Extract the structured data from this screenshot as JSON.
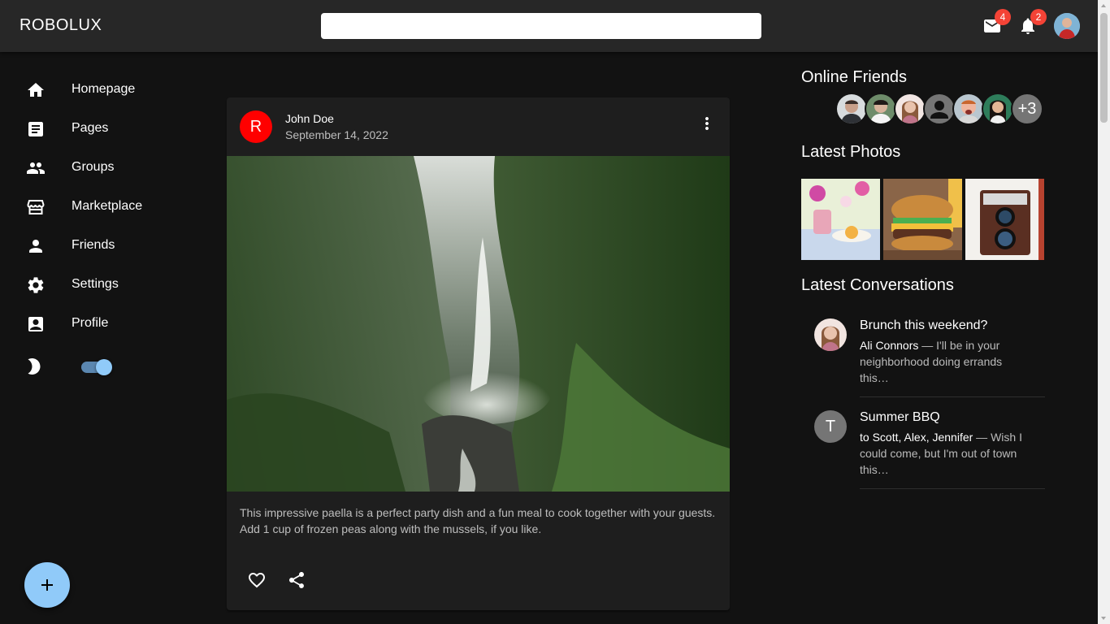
{
  "app": {
    "brand": "ROBOLUX"
  },
  "header": {
    "search_placeholder": "",
    "mail_count": "4",
    "notification_count": "2"
  },
  "sidebar": {
    "items": [
      {
        "label": "Homepage",
        "icon": "home-icon"
      },
      {
        "label": "Pages",
        "icon": "article-icon"
      },
      {
        "label": "Groups",
        "icon": "group-icon"
      },
      {
        "label": "Marketplace",
        "icon": "storefront-icon"
      },
      {
        "label": "Friends",
        "icon": "person-icon"
      },
      {
        "label": "Settings",
        "icon": "gear-icon"
      },
      {
        "label": "Profile",
        "icon": "account-box-icon"
      }
    ],
    "dark_mode_enabled": true
  },
  "post": {
    "avatar_letter": "R",
    "author": "John Doe",
    "date": "September 14, 2022",
    "image_subject": "jungle waterfall",
    "text": "This impressive paella is a perfect party dish and a fun meal to cook together with your guests. Add 1 cup of frozen peas along with the mussels, if you like."
  },
  "right": {
    "online_friends_title": "Online Friends",
    "online_friends_more": "+3",
    "latest_photos_title": "Latest Photos",
    "latest_conversations_title": "Latest Conversations",
    "conversations": [
      {
        "title": "Brunch this weekend?",
        "who": "Ali Connors",
        "snippet": " — I'll be in your neighborhood doing errands this…",
        "avatar_letter": ""
      },
      {
        "title": "Summer BBQ",
        "who": "to Scott, Alex, Jennifer",
        "snippet": " — Wish I could come, but I'm out of town this…",
        "avatar_letter": "T"
      }
    ]
  },
  "colors": {
    "background": "#121212",
    "appbar": "#272727",
    "card": "#1e1e1e",
    "accent": "#90caf9",
    "badge": "#f44336",
    "post_avatar": "#ff0000"
  }
}
